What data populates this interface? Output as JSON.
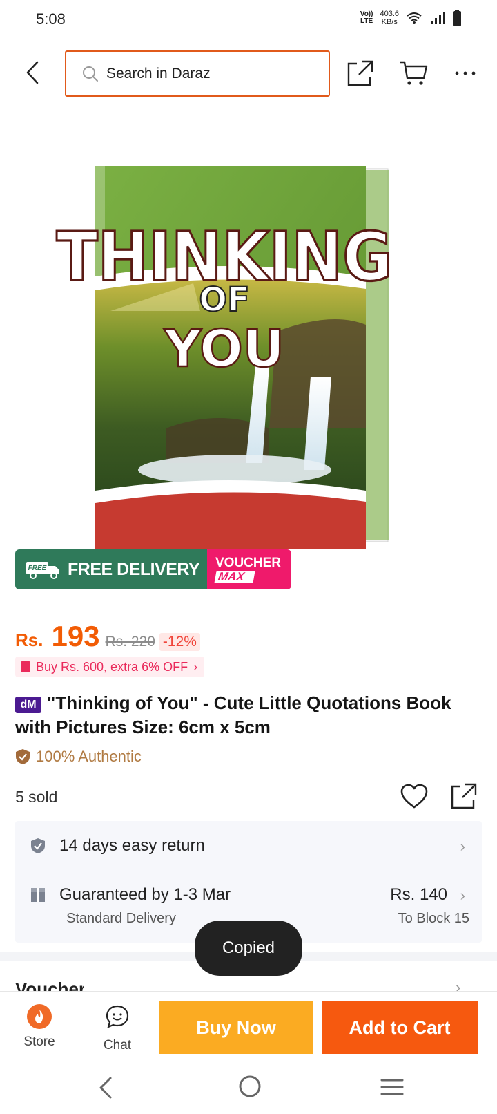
{
  "status": {
    "time": "5:08",
    "network_label_top": "Vo))",
    "network_label_bottom": "LTE",
    "speed_value": "403.6",
    "speed_unit": "KB/s"
  },
  "header": {
    "search_placeholder": "Search in Daraz"
  },
  "product_image": {
    "cover_title_1": "THINKING",
    "cover_title_2": "OF",
    "cover_title_3": "YOU"
  },
  "banner": {
    "truck_label": "FREE",
    "free_delivery": "FREE DELIVERY",
    "voucher_top": "VOUCHER",
    "voucher_bottom": "MAX"
  },
  "price": {
    "currency": "Rs.",
    "value": "193",
    "original": "Rs. 220",
    "discount": "-12%"
  },
  "promo": {
    "text": "Buy Rs. 600, extra 6% OFF",
    "chevron": "›"
  },
  "title": {
    "badge": "dM",
    "text": "\"Thinking of You\" - Cute Little Quotations Book with Pictures Size: 6cm x 5cm"
  },
  "authentic": {
    "text": "100% Authentic"
  },
  "sold": {
    "text": "5 sold"
  },
  "service": {
    "return_text": "14 days easy return",
    "delivery_text": "Guaranteed by 1-3 Mar",
    "delivery_price": "Rs. 140",
    "delivery_type": "Standard Delivery",
    "delivery_location": "To Block 15",
    "chevron": "›"
  },
  "partial_section": {
    "label": "Vouchers",
    "chevron": "›"
  },
  "toast": {
    "text": "Copied"
  },
  "bottom_bar": {
    "store_label": "Store",
    "chat_label": "Chat",
    "buy_now_label": "Buy Now",
    "add_to_cart_label": "Add to Cart"
  },
  "colors": {
    "brand_orange": "#f6590f",
    "buy_now_yellow": "#fbab22",
    "price_orange": "#f25c05",
    "banner_green": "#2f7a5a",
    "voucher_pink": "#ef1a6b"
  }
}
